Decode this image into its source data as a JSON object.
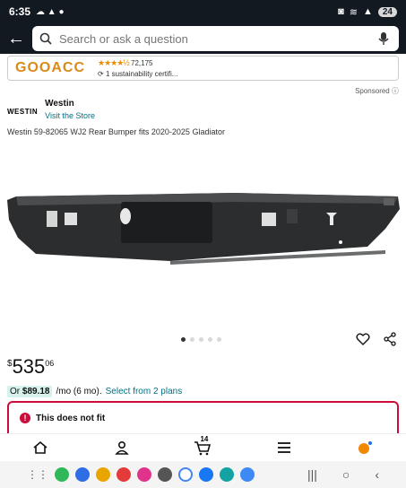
{
  "status": {
    "time": "6:35",
    "battery": "24"
  },
  "search": {
    "placeholder": "Search or ask a question"
  },
  "ad": {
    "logo_text": "GOOACC",
    "rating_count": "72,175",
    "sustainability": "1 sustainability certifi..."
  },
  "sponsored": "Sponsored",
  "brand": {
    "logo_text": "WESTIN",
    "name": "Westin",
    "store_link": "Visit the Store"
  },
  "product": {
    "title": "Westin 59-82065 WJ2 Rear Bumper fits 2020-2025 Gladiator",
    "image_dots": 5,
    "active_dot": 0
  },
  "price": {
    "symbol": "$",
    "whole": "535",
    "fraction": "06"
  },
  "financing": {
    "prefix": "Or",
    "amount": "$89.18",
    "term": "/mo (6 mo).",
    "link": "Select from 2 plans"
  },
  "fit": {
    "message": "This does not fit"
  },
  "bottom_nav": {
    "cart_count": "14"
  },
  "colors": {
    "header": "#131921",
    "link": "#007185",
    "alert": "#cc0c39",
    "star": "#e88b00"
  }
}
